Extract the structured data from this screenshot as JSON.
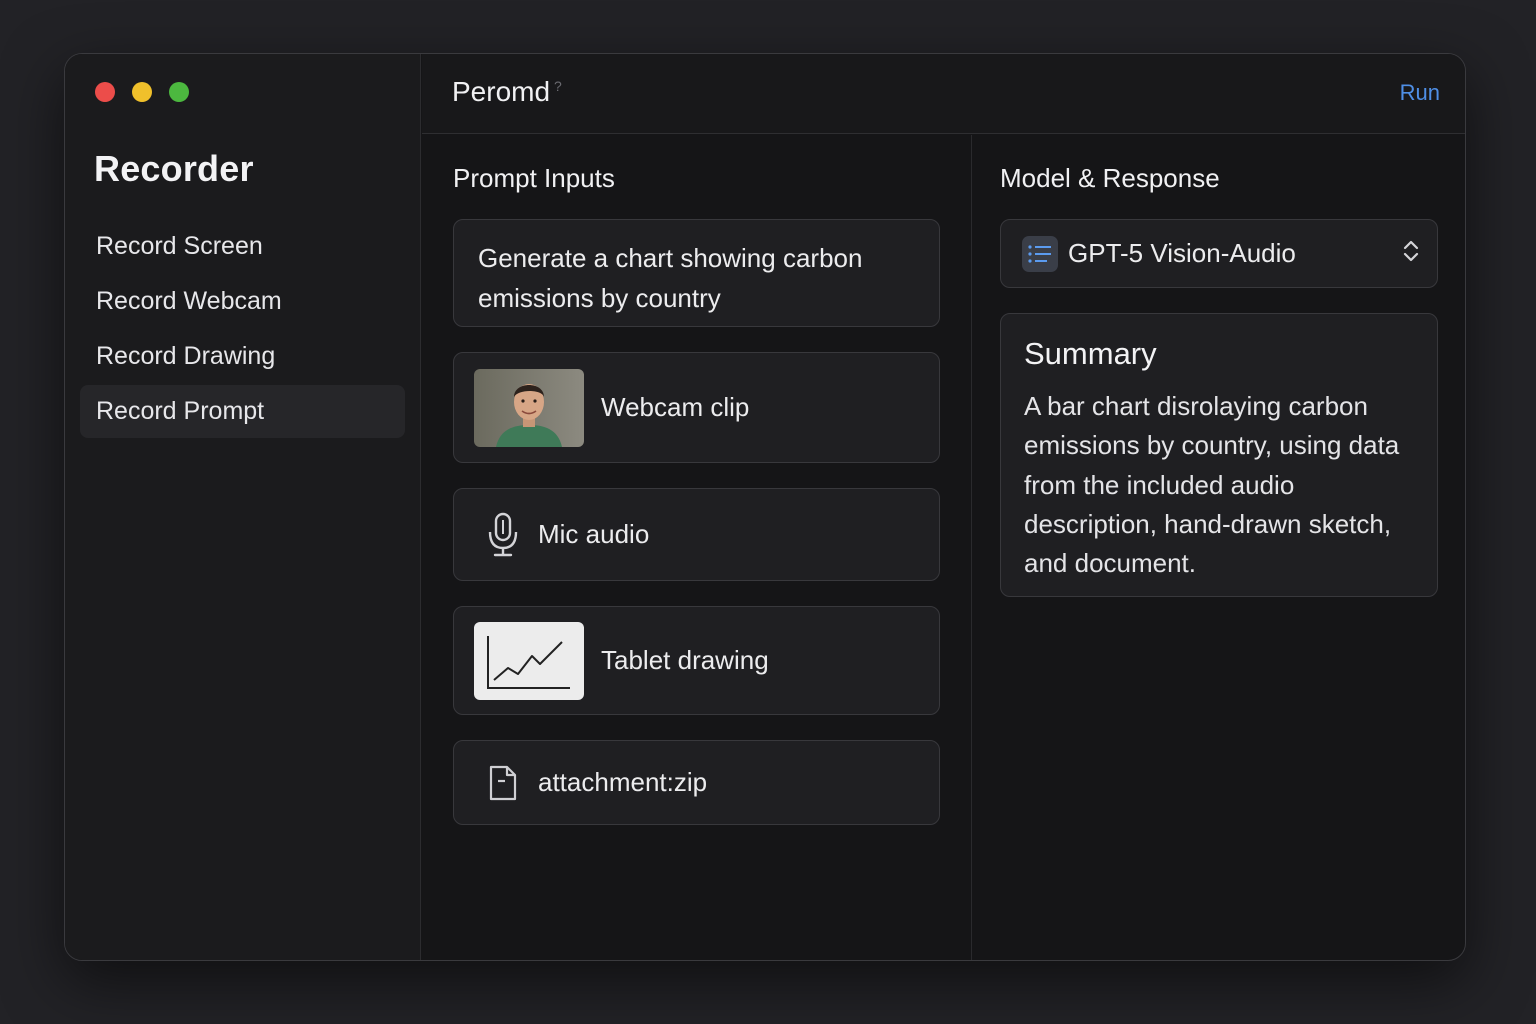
{
  "sidebar": {
    "title": "Recorder",
    "items": [
      {
        "label": "Record Screen",
        "active": false
      },
      {
        "label": "Record Webcam",
        "active": false
      },
      {
        "label": "Record Drawing",
        "active": false
      },
      {
        "label": "Record Prompt",
        "active": true
      }
    ]
  },
  "header": {
    "title": "Peromd",
    "title_mark": "?",
    "run_label": "Run"
  },
  "prompt_inputs": {
    "title": "Prompt Inputs",
    "prompt_text": "Generate a chart showing carbon emissions by country",
    "webcam_label": "Webcam clip",
    "mic_label": "Mic audio",
    "drawing_label": "Tablet drawing",
    "attachment_label": "attachment:zip"
  },
  "model_response": {
    "title": "Model & Response",
    "model_selected": "GPT-5 Vision-Audio",
    "summary_title": "Summary",
    "summary_text": "A bar chart disrolaying carbon emissions by country, using data from the included audio description, hand-drawn sketch, and document."
  },
  "colors": {
    "window_bg": "#151517",
    "sidebar_bg": "#1b1b1d",
    "card_bg": "#1f1f22",
    "accent_link": "#4f8fe6",
    "traffic_red": "#ec4d4a",
    "traffic_yellow": "#f0c02b",
    "traffic_green": "#4cb83f"
  },
  "icons": [
    "close-icon",
    "minimize-icon",
    "zoom-icon",
    "microphone-icon",
    "document-icon",
    "list-icon",
    "chevron-up-down-icon"
  ]
}
